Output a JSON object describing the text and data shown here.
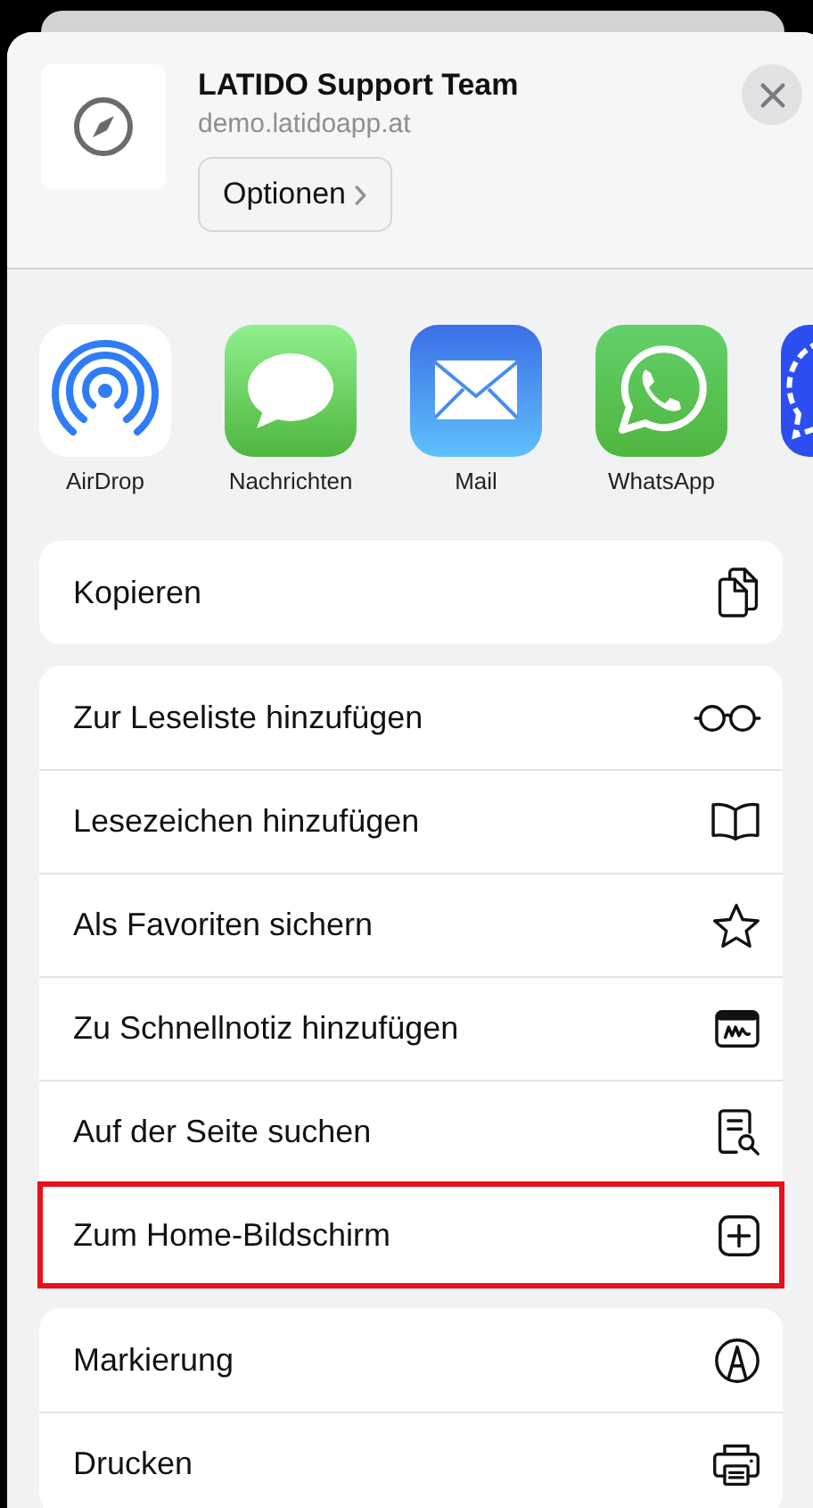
{
  "header": {
    "title": "LATIDO Support Team",
    "subtitle": "demo.latidoapp.at",
    "options_button": "Optionen"
  },
  "apps": [
    {
      "kind": "airdrop",
      "label": "AirDrop"
    },
    {
      "kind": "messages",
      "label": "Nachrichten"
    },
    {
      "kind": "mail",
      "label": "Mail"
    },
    {
      "kind": "whatsapp",
      "label": "WhatsApp"
    },
    {
      "kind": "signal"
    }
  ],
  "action_groups": [
    [
      {
        "label": "Kopieren",
        "kind": "copy",
        "highlighted": false
      }
    ],
    [
      {
        "label": "Zur Leseliste hinzufügen",
        "kind": "glasses",
        "highlighted": false
      },
      {
        "label": "Lesezeichen hinzufügen",
        "kind": "book",
        "highlighted": false
      },
      {
        "label": "Als Favoriten sichern",
        "kind": "star",
        "highlighted": false
      },
      {
        "label": "Zu Schnellnotiz hinzufügen",
        "kind": "note",
        "highlighted": false
      },
      {
        "label": "Auf der Seite suchen",
        "kind": "find",
        "highlighted": false
      },
      {
        "label": "Zum Home-Bildschirm",
        "kind": "addsquare",
        "highlighted": true
      }
    ],
    [
      {
        "label": "Markierung",
        "kind": "markup",
        "highlighted": false
      },
      {
        "label": "Drucken",
        "kind": "print",
        "highlighted": false
      }
    ]
  ]
}
